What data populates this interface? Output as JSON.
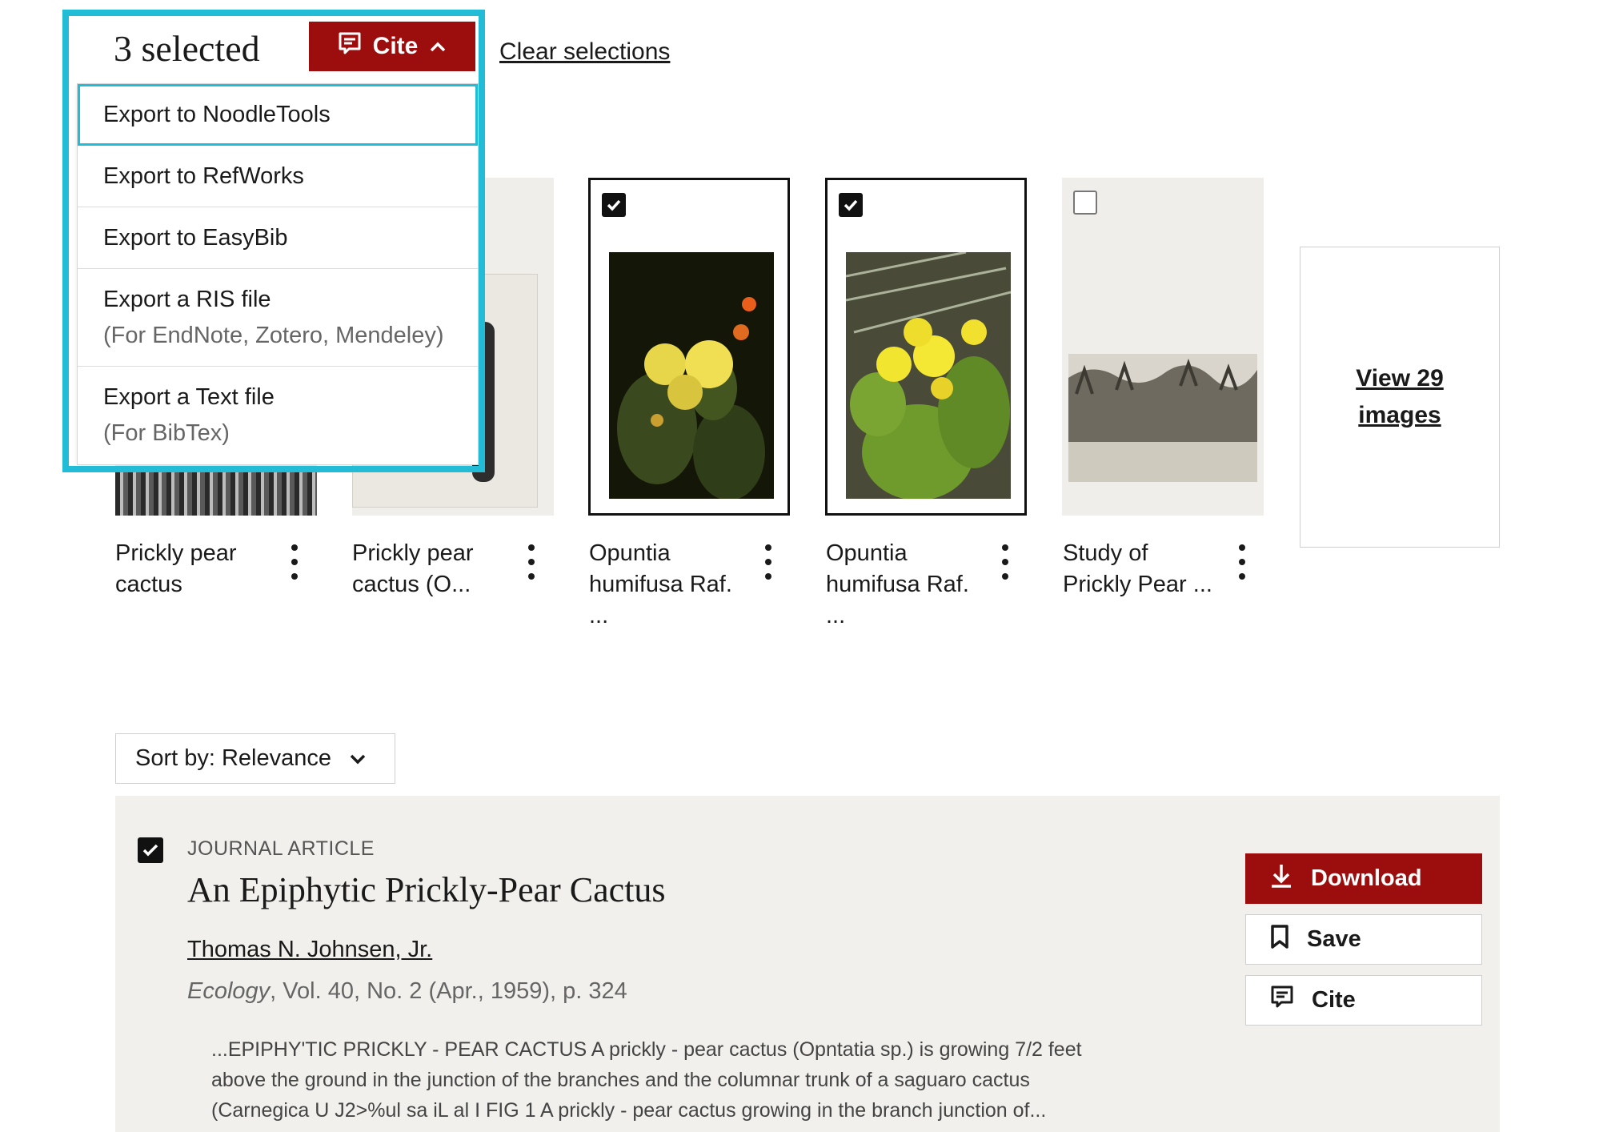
{
  "toolbar": {
    "selected_count": "3 selected",
    "cite_label": "Cite",
    "clear_label": "Clear selections"
  },
  "cite_menu": {
    "items": [
      {
        "label": "Export to NoodleTools"
      },
      {
        "label": "Export to RefWorks"
      },
      {
        "label": "Export to EasyBib"
      },
      {
        "label": "Export a RIS file",
        "sub": "(For EndNote, Zotero, Mendeley)"
      },
      {
        "label": "Export a Text file",
        "sub": "(For BibTex)"
      }
    ]
  },
  "images": {
    "cards": [
      {
        "title": "Prickly pear\ncactus",
        "checked": false
      },
      {
        "title": "Prickly pear\ncactus (O...",
        "checked": false
      },
      {
        "title": "Opuntia\nhumifusa Raf.\n...",
        "checked": true
      },
      {
        "title": "Opuntia\nhumifusa Raf.\n...",
        "checked": true
      },
      {
        "title": "Study of\nPrickly Pear ...",
        "checked": false
      }
    ],
    "view_all_label": "View 29 images"
  },
  "sort": {
    "label": "Sort by: Relevance"
  },
  "result": {
    "type": "JOURNAL ARTICLE",
    "title": "An Epiphytic Prickly-Pear Cactus",
    "author": "Thomas N. Johnsen, Jr.",
    "journal": "Ecology",
    "source_rest": ", Vol. 40, No. 2 (Apr., 1959), p. 324",
    "snippet_lines": [
      "...EPIPHY'TIC PRICKLY - PEAR CACTUS A prickly - pear cactus (Opntatia sp.) is growing 7/2 feet",
      "above the ground in the junction of the branches and the columnar trunk of a saguaro cactus",
      "(Carnegica U J2>%ul sa iL al I FIG 1 A prickly - pear cactus growing in the branch junction of..."
    ],
    "download_label": "Download",
    "save_label": "Save",
    "cite_label": "Cite"
  },
  "colors": {
    "accent": "#9c0d0d",
    "highlight": "#22bcd6",
    "result_bg": "#f1f0ed"
  }
}
